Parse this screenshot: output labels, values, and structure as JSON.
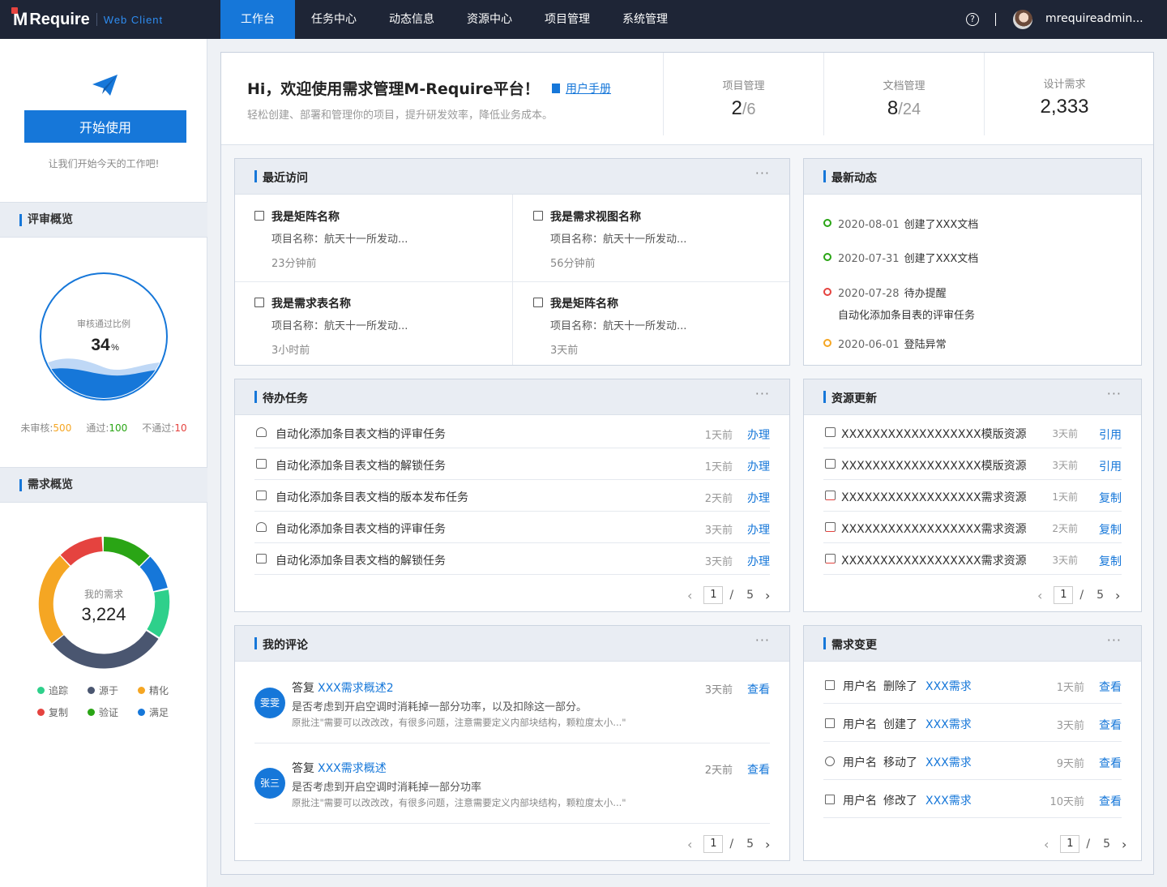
{
  "app": {
    "brand_m": "M",
    "brand_name": "Require",
    "brand_sub": "Web Client"
  },
  "nav": [
    "工作台",
    "任务中心",
    "动态信息",
    "资源中心",
    "项目管理",
    "系统管理"
  ],
  "user": {
    "help": "?",
    "name": "mrequireadmin..."
  },
  "sidebar": {
    "start_button": "开始使用",
    "tagline": "让我们开始今天的工作吧!",
    "review": {
      "title": "评审概览",
      "gauge_label": "审核通过比例",
      "gauge_value": "34",
      "gauge_unit": "%",
      "legend": [
        {
          "label": "未审核:",
          "value": "500",
          "color": "#f5a623"
        },
        {
          "label": "通过:",
          "value": "100",
          "color": "#2aa515"
        },
        {
          "label": "不通过:",
          "value": "10",
          "color": "#e5433f"
        }
      ]
    },
    "demand": {
      "title": "需求概览",
      "center_label": "我的需求",
      "center_value": "3,224",
      "legend": [
        {
          "label": "追踪",
          "color": "#2ed08b"
        },
        {
          "label": "源于",
          "color": "#4a5670"
        },
        {
          "label": "精化",
          "color": "#f5a623"
        },
        {
          "label": "复制",
          "color": "#e5433f"
        },
        {
          "label": "验证",
          "color": "#2aa515"
        },
        {
          "label": "满足",
          "color": "#1677d9"
        }
      ]
    }
  },
  "welcome": {
    "title": "Hi，欢迎使用需求管理M-Require平台！",
    "manual": "用户手册",
    "subtitle": "轻松创建、部署和管理你的项目，提升研发效率，降低业务成本。",
    "stats": [
      {
        "label": "项目管理",
        "value": "2",
        "total": "/6"
      },
      {
        "label": "文档管理",
        "value": "8",
        "total": "/24"
      },
      {
        "label": "设计需求",
        "value": "2,333",
        "total": ""
      }
    ]
  },
  "recent": {
    "title": "最近访问",
    "more": "···",
    "items": [
      {
        "name": "我是矩阵名称",
        "project": "项目名称：航天十一所发动...",
        "time": "23分钟前"
      },
      {
        "name": "我是需求视图名称",
        "project": "项目名称：航天十一所发动...",
        "time": "56分钟前"
      },
      {
        "name": "我是需求表名称",
        "project": "项目名称：航天十一所发动...",
        "time": "3小时前"
      },
      {
        "name": "我是矩阵名称",
        "project": "项目名称：航天十一所发动...",
        "time": "3天前"
      }
    ]
  },
  "activity": {
    "title": "最新动态",
    "items": [
      {
        "date": "2020-08-01",
        "text": "创建了XXX文档",
        "extra": "",
        "color": "#2aa515"
      },
      {
        "date": "2020-07-31",
        "text": "创建了XXX文档",
        "extra": "",
        "color": "#2aa515"
      },
      {
        "date": "2020-07-28",
        "text": "待办提醒",
        "extra": "自动化添加条目表的评审任务",
        "color": "#e5433f"
      },
      {
        "date": "2020-06-01",
        "text": "登陆异常",
        "extra": "",
        "color": "#f5a623"
      }
    ]
  },
  "todo": {
    "title": "待办任务",
    "items": [
      {
        "text": "自动化添加条目表文档的评审任务",
        "time": "1天前",
        "action": "办理"
      },
      {
        "text": "自动化添加条目表文档的解锁任务",
        "time": "1天前",
        "action": "办理"
      },
      {
        "text": "自动化添加条目表文档的版本发布任务",
        "time": "2天前",
        "action": "办理"
      },
      {
        "text": "自动化添加条目表文档的评审任务",
        "time": "3天前",
        "action": "办理"
      },
      {
        "text": "自动化添加条目表文档的解锁任务",
        "time": "3天前",
        "action": "办理"
      }
    ],
    "pager": {
      "current": "1",
      "sep": "/",
      "total": "5"
    }
  },
  "resources": {
    "title": "资源更新",
    "items": [
      {
        "text": "XXXXXXXXXXXXXXXXXX模版资源",
        "time": "3天前",
        "action": "引用"
      },
      {
        "text": "XXXXXXXXXXXXXXXXXX模版资源",
        "time": "3天前",
        "action": "引用"
      },
      {
        "text": "XXXXXXXXXXXXXXXXXX需求资源",
        "time": "1天前",
        "action": "复制"
      },
      {
        "text": "XXXXXXXXXXXXXXXXXX需求资源",
        "time": "2天前",
        "action": "复制"
      },
      {
        "text": "XXXXXXXXXXXXXXXXXX需求资源",
        "time": "3天前",
        "action": "复制"
      }
    ],
    "pager": {
      "current": "1",
      "sep": "/",
      "total": "5"
    }
  },
  "comments": {
    "title": "我的评论",
    "items": [
      {
        "avatar": "雯雯",
        "prefix": "答复",
        "link": "XXX需求概述2",
        "body": "是否考虑到开启空调时消耗掉一部分功率，以及扣除这一部分。",
        "quote": "原批注\"需要可以改改改，有很多问题，注意需要定义内部块结构，颗粒度太小...\"",
        "time": "3天前",
        "action": "查看"
      },
      {
        "avatar": "张三",
        "prefix": "答复",
        "link": "XXX需求概述",
        "body": "是否考虑到开启空调时消耗掉一部分功率",
        "quote": "原批注\"需要可以改改改，有很多问题，注意需要定义内部块结构，颗粒度太小...\"",
        "time": "2天前",
        "action": "查看"
      }
    ],
    "pager": {
      "current": "1",
      "sep": "/",
      "total": "5"
    }
  },
  "changes": {
    "title": "需求变更",
    "items": [
      {
        "user": "用户名",
        "verb": "删除了",
        "object": "XXX需求",
        "time": "1天前",
        "action": "查看",
        "icon": "trash-icon"
      },
      {
        "user": "用户名",
        "verb": "创建了",
        "object": "XXX需求",
        "time": "3天前",
        "action": "查看",
        "icon": "file-add-icon"
      },
      {
        "user": "用户名",
        "verb": "移动了",
        "object": "XXX需求",
        "time": "9天前",
        "action": "查看",
        "icon": "move-icon"
      },
      {
        "user": "用户名",
        "verb": "修改了",
        "object": "XXX需求",
        "time": "10天前",
        "action": "查看",
        "icon": "edit-icon"
      }
    ],
    "pager": {
      "current": "1",
      "sep": "/",
      "total": "5"
    }
  },
  "colors": {
    "primary": "#1677d9",
    "topbar": "#1e2536",
    "section_bg": "#e9edf3"
  }
}
